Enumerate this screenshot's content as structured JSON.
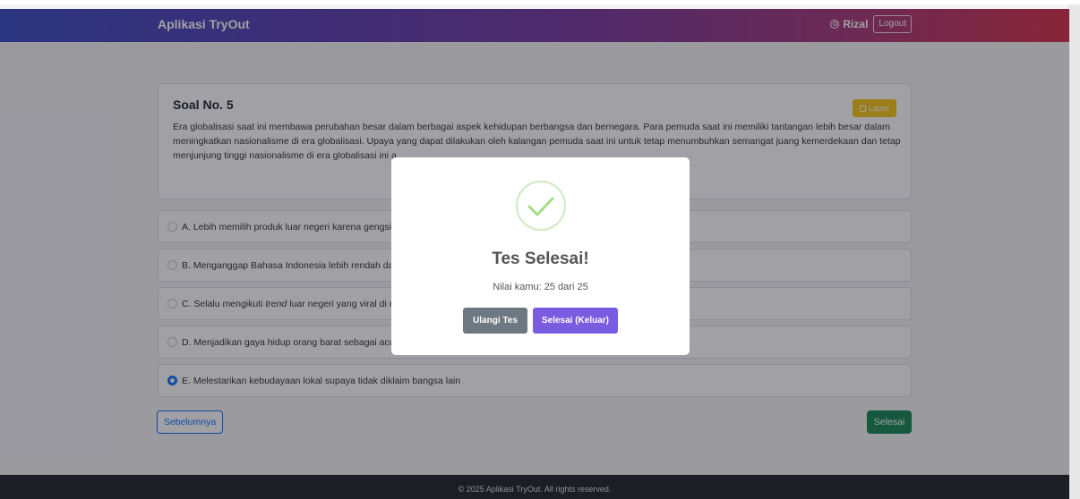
{
  "navbar": {
    "brand": "Aplikasi TryOut",
    "user_name": "Rizal",
    "logout_label": "Logout"
  },
  "question": {
    "title": "Soal No. 5",
    "report_label": "Lapor",
    "text_visible": "Era globalisasi saat ini membawa perubahan besar dalam berbagai aspek kehidupan berbangsa dan bernegara. Para pemuda saat ini memiliki tantangan lebih besar dalam meningkatkan nasionalisme di era globalisasi. Upaya yang dapat dilakukan oleh kalangan pemuda saat ini untuk tetap menumbuhkan semangat juang kemerdekaan dan tetap menjunjung tinggi nasionalisme di era globalisasi ini a"
  },
  "options": [
    {
      "text": "A. Lebih memilih produk luar negeri karena gengsi d",
      "checked": false
    },
    {
      "text": "B. Menganggap Bahasa Indonesia lebih rendah dari",
      "checked": false
    },
    {
      "text_before": "C. Selalu mengikuti ",
      "text_em": "trend",
      "text_after": " luar negeri yang viral di m",
      "checked": false
    },
    {
      "text": "D. Menjadikan gaya hidup orang barat sebagai acua",
      "checked": false
    },
    {
      "text": "E. Melestarikan kebudayaan lokal supaya tidak diklaim bangsa lain",
      "checked": true
    }
  ],
  "navigation": {
    "prev_label": "Sebelumnya",
    "finish_label": "Selesai"
  },
  "footer": {
    "text": "© 2025 Aplikasi TryOut. All rights reserved."
  },
  "modal": {
    "title": "Tes Selesai!",
    "score_text": "Nilai kamu: 25 dari 25",
    "retry_label": "Ulangi Tes",
    "exit_label": "Selesai (Keluar)",
    "icon": "success-check-icon"
  },
  "colors": {
    "primary": "#0d6efd",
    "success": "#198754",
    "warning": "#f5c316",
    "modal_exit": "#7a5ce0",
    "modal_retry": "#6e7881",
    "check": "#a5dc86"
  }
}
